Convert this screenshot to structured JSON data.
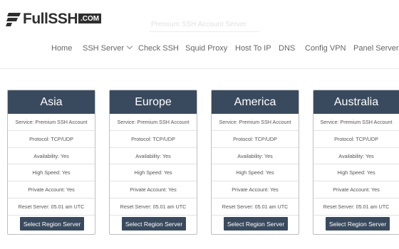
{
  "brand": {
    "name": "FullSSH",
    "badge": ".COM"
  },
  "search": {
    "placeholder": "Premium SSH Account Server"
  },
  "nav": {
    "items": [
      {
        "label": "Home"
      },
      {
        "label": "SSH Server"
      },
      {
        "label": "Check SSH"
      },
      {
        "label": "Squid Proxy"
      },
      {
        "label": "Host To IP"
      },
      {
        "label": "DNS"
      },
      {
        "label": "Config VPN"
      },
      {
        "label": "Panel Servers"
      }
    ]
  },
  "regions": [
    {
      "name": "Asia",
      "rows": [
        "Service: Premium SSH Account",
        "Protocol: TCP/UDP",
        "Availability: Yes",
        "High Speed: Yes",
        "Private Account: Yes",
        "Reset Server: 05.01 am UTC"
      ],
      "button": "Select Region Server"
    },
    {
      "name": "Europe",
      "rows": [
        "Service: Premium SSH Account",
        "Protocol: TCP/UDP",
        "Availability: Yes",
        "High Speed: Yes",
        "Private Account: Yes",
        "Reset Server: 05.01 am UTC"
      ],
      "button": "Select Region Server"
    },
    {
      "name": "America",
      "rows": [
        "Service: Premium SSH Account",
        "Protocol: TCP/UDP",
        "Availability: Yes",
        "High Speed: Yes",
        "Private Account: Yes",
        "Reset Server: 05.01 am UTC"
      ],
      "button": "Select Region Server"
    },
    {
      "name": "Australia",
      "rows": [
        "Service: Premium SSH Account",
        "Protocol: TCP/UDP",
        "Availability: Yes",
        "High Speed: Yes",
        "Private Account: Yes",
        "Reset Server: 05.01 am UTC"
      ],
      "button": "Select Region Server"
    }
  ],
  "colors": {
    "card_header": "#3a4a5e",
    "button": "#3a4a5e",
    "logo": "#2f2f2f"
  },
  "icons": {
    "logo": "stacked-bars-logo-icon",
    "nav_dropdown": "chevron-down-icon"
  }
}
